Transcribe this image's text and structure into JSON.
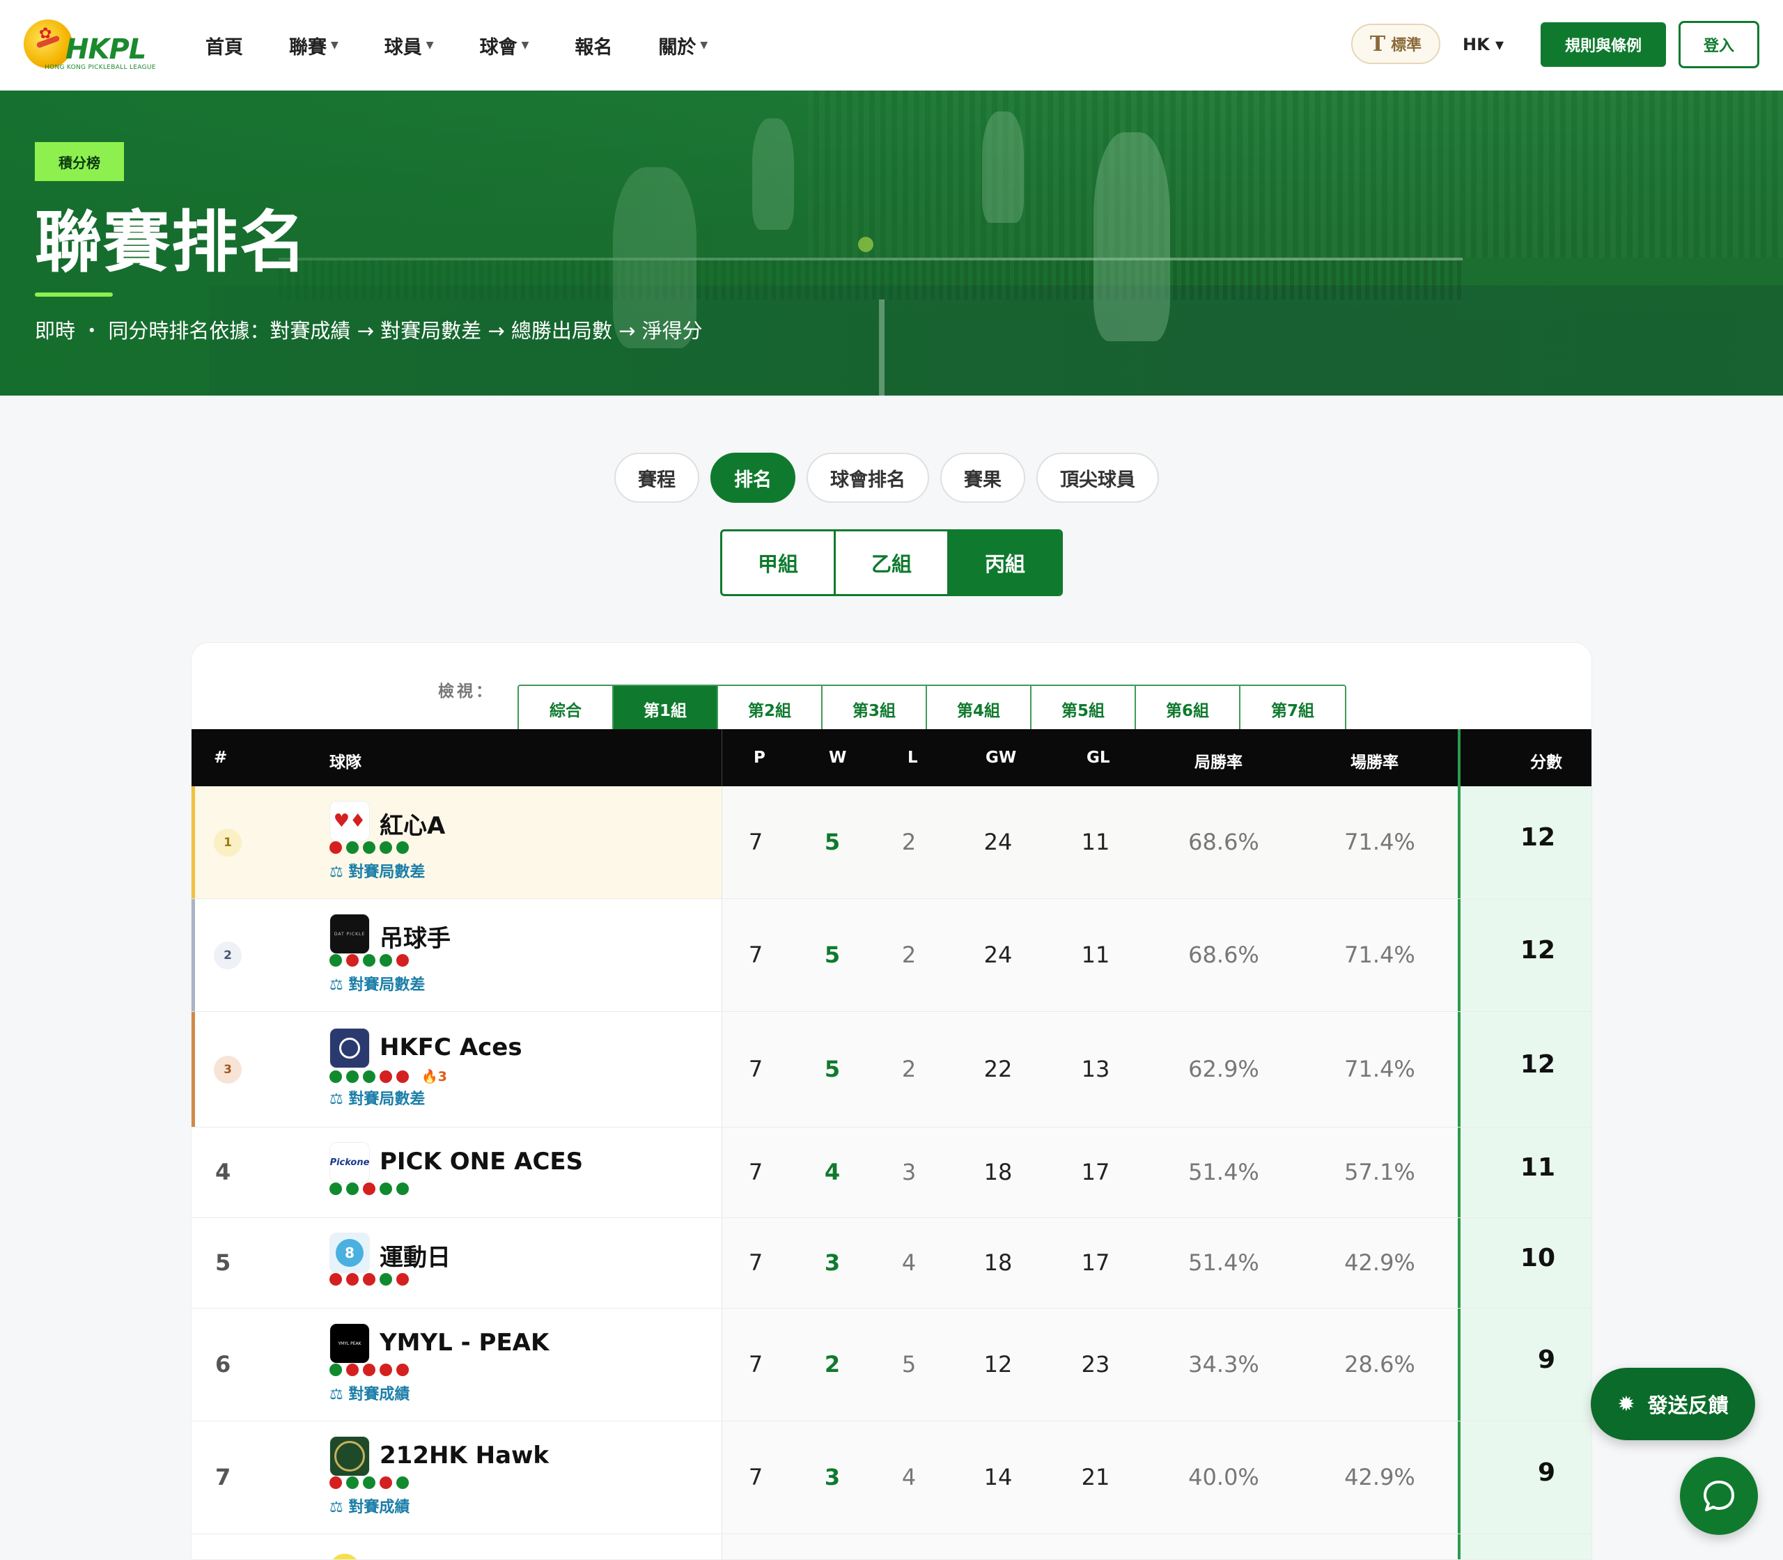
{
  "nav": {
    "logo_text": "HKPL",
    "logo_sub": "HONG KONG PICKLEBALL LEAGUE",
    "links": [
      "首頁",
      "聯賽",
      "球員",
      "球會",
      "報名",
      "關於"
    ],
    "font_label": "標準",
    "lang": "HK ▾",
    "rules_label": "規則與條例",
    "login_label": "登入"
  },
  "hero": {
    "badge": "積分榜",
    "title": "聯賽排名",
    "subtitle": "即時 ・ 同分時排名依據：對賽成績 → 對賽局數差 → 總勝出局數 → 淨得分"
  },
  "tabs": [
    "賽程",
    "排名",
    "球會排名",
    "賽果",
    "頂尖球員"
  ],
  "divisions": [
    "甲組",
    "乙組",
    "丙組"
  ],
  "view": {
    "label": "檢視：",
    "groups": [
      "綜合",
      "第1組",
      "第2組",
      "第3組",
      "第4組",
      "第5組",
      "第6組",
      "第7組"
    ]
  },
  "table": {
    "headers": [
      "#",
      "球隊",
      "P",
      "W",
      "L",
      "GW",
      "GL",
      "局勝率",
      "場勝率",
      "分數"
    ],
    "rows": [
      {
        "rank": "1",
        "name": "紅心A",
        "form": [
          "l",
          "w",
          "w",
          "w",
          "w"
        ],
        "streak": "",
        "tie": "⚖ 對賽局數差",
        "p": "7",
        "w": "5",
        "l": "2",
        "gw": "24",
        "gl": "11",
        "gpct": "68.6%",
        "mpct": "71.4%",
        "pts": "12"
      },
      {
        "rank": "2",
        "name": "吊球手",
        "form": [
          "w",
          "l",
          "w",
          "w",
          "l"
        ],
        "streak": "",
        "tie": "⚖ 對賽局數差",
        "p": "7",
        "w": "5",
        "l": "2",
        "gw": "24",
        "gl": "11",
        "gpct": "68.6%",
        "mpct": "71.4%",
        "pts": "12"
      },
      {
        "rank": "3",
        "name": "HKFC Aces",
        "form": [
          "w",
          "w",
          "w",
          "l",
          "l"
        ],
        "streak": "🔥3",
        "tie": "⚖ 對賽局數差",
        "p": "7",
        "w": "5",
        "l": "2",
        "gw": "22",
        "gl": "13",
        "gpct": "62.9%",
        "mpct": "71.4%",
        "pts": "12"
      },
      {
        "rank": "4",
        "name": "PICK ONE ACES",
        "form": [
          "w",
          "w",
          "l",
          "w",
          "w"
        ],
        "streak": "",
        "tie": "",
        "p": "7",
        "w": "4",
        "l": "3",
        "gw": "18",
        "gl": "17",
        "gpct": "51.4%",
        "mpct": "57.1%",
        "pts": "11"
      },
      {
        "rank": "5",
        "name": "運動日",
        "form": [
          "l",
          "l",
          "l",
          "w",
          "l"
        ],
        "streak": "",
        "tie": "",
        "p": "7",
        "w": "3",
        "l": "4",
        "gw": "18",
        "gl": "17",
        "gpct": "51.4%",
        "mpct": "42.9%",
        "pts": "10"
      },
      {
        "rank": "6",
        "name": "YMYL - PEAK",
        "form": [
          "w",
          "l",
          "l",
          "l",
          "l"
        ],
        "streak": "",
        "tie": "⚖ 對賽成績",
        "p": "7",
        "w": "2",
        "l": "5",
        "gw": "12",
        "gl": "23",
        "gpct": "34.3%",
        "mpct": "28.6%",
        "pts": "9"
      },
      {
        "rank": "7",
        "name": "212HK Hawk",
        "form": [
          "l",
          "w",
          "w",
          "l",
          "w"
        ],
        "streak": "",
        "tie": "⚖ 對賽成績",
        "p": "7",
        "w": "3",
        "l": "4",
        "gw": "14",
        "gl": "21",
        "gpct": "40.0%",
        "mpct": "42.9%",
        "pts": "9"
      },
      {
        "rank": "",
        "name": "",
        "form": [],
        "streak": "",
        "tie": "",
        "p": "",
        "w": "",
        "l": "",
        "gw": "",
        "gl": "",
        "gpct": "",
        "mpct": "",
        "pts": ""
      }
    ]
  },
  "feedback_label": "發送反饋",
  "colors": {
    "primary": "#0f7a2e",
    "accent": "#8ef04e",
    "win": "#118a2f",
    "loss": "#d42020",
    "gold": "#f0c040",
    "silver": "#a9b4c4",
    "bronze": "#d08a4a"
  }
}
